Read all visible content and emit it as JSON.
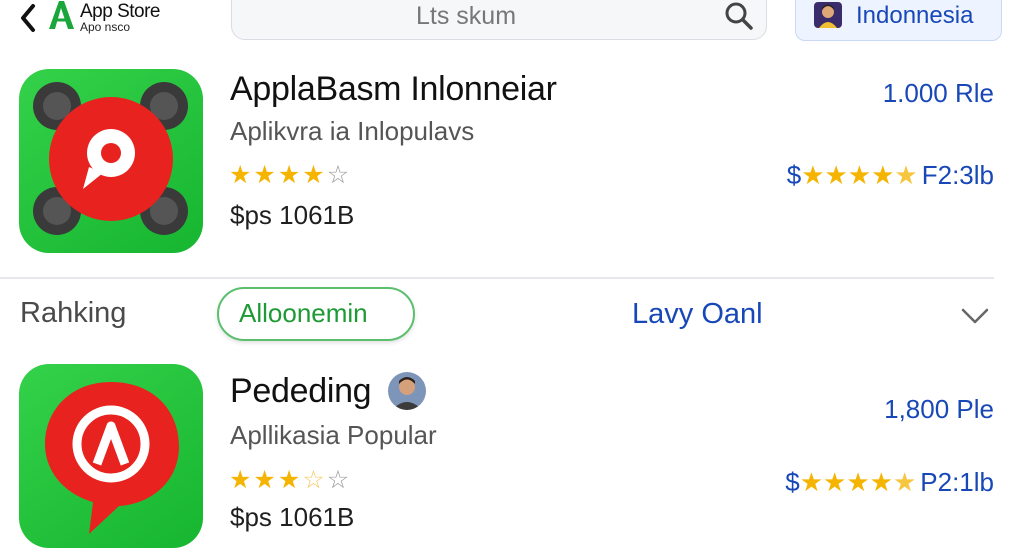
{
  "header": {
    "back_icon": "chevron-left-icon",
    "logo_icon": "app-store-logo-icon",
    "title": "App Store",
    "subtitle": "Apo nsco",
    "search": {
      "value": "Lts skum",
      "icon": "search-icon"
    },
    "region": {
      "label": "Indonnesia",
      "icon": "flag-avatar-icon"
    }
  },
  "apps": [
    {
      "name": "ApplaBasm Inlonneiar",
      "subtitle": "Aplikvra ia Inlopulavs",
      "rating": 4,
      "price": "$ps 1061B",
      "right_value": "1.000 Rle",
      "right_rating_text": "F2:3lb",
      "right_rating_prefix": "$",
      "right_rating": 4.5,
      "icon": "pin-dots-app-icon"
    },
    {
      "name": "Pededing",
      "subtitle": "Apllikasia Popular",
      "rating": 3,
      "price": "$ps 1061B",
      "right_value": "1,800 Ple",
      "right_rating_text": "P2:1lb",
      "right_rating_prefix": "$",
      "right_rating": 4.5,
      "icon": "chat-pin-app-icon",
      "avatar": "developer-avatar-icon"
    }
  ],
  "filters": {
    "ranking_label": "Rahking",
    "chip_label": "Alloonemin",
    "category_label": "Lavy Oanl",
    "dropdown_icon": "chevron-down-icon"
  },
  "colors": {
    "accent_blue": "#1848b8",
    "app_green": "#1fbf3a",
    "star_gold": "#f4b400",
    "icon_red": "#e8231f"
  }
}
